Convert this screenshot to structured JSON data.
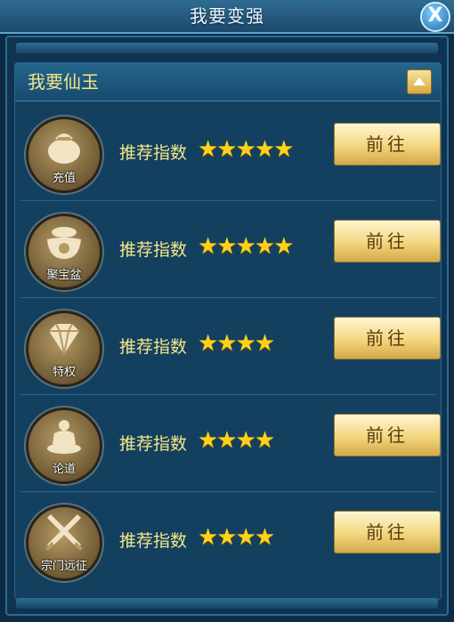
{
  "window": {
    "title": "我要变强",
    "close_label": "X"
  },
  "section": {
    "title": "我要仙玉"
  },
  "rows": [
    {
      "badge": "充值",
      "icon": "money-bag-icon",
      "rec_label": "推荐指数",
      "stars": "★★★★★",
      "rating": 5,
      "button": "前往"
    },
    {
      "badge": "聚宝盆",
      "icon": "treasure-bowl-icon",
      "rec_label": "推荐指数",
      "stars": "★★★★★",
      "rating": 5,
      "button": "前往"
    },
    {
      "badge": "特权",
      "icon": "diamond-icon",
      "rec_label": "推荐指数",
      "stars": "★★★★",
      "rating": 4,
      "button": "前往"
    },
    {
      "badge": "论道",
      "icon": "meditation-icon",
      "rec_label": "推荐指数",
      "stars": "★★★★",
      "rating": 4,
      "button": "前往"
    },
    {
      "badge": "宗门远征",
      "icon": "crossed-swords-icon",
      "rec_label": "推荐指数",
      "stars": "★★★★",
      "rating": 4,
      "button": "前往"
    }
  ],
  "colors": {
    "accent_text": "#f3e58a",
    "star": "#ffd21a",
    "button": "#f3d67d"
  }
}
